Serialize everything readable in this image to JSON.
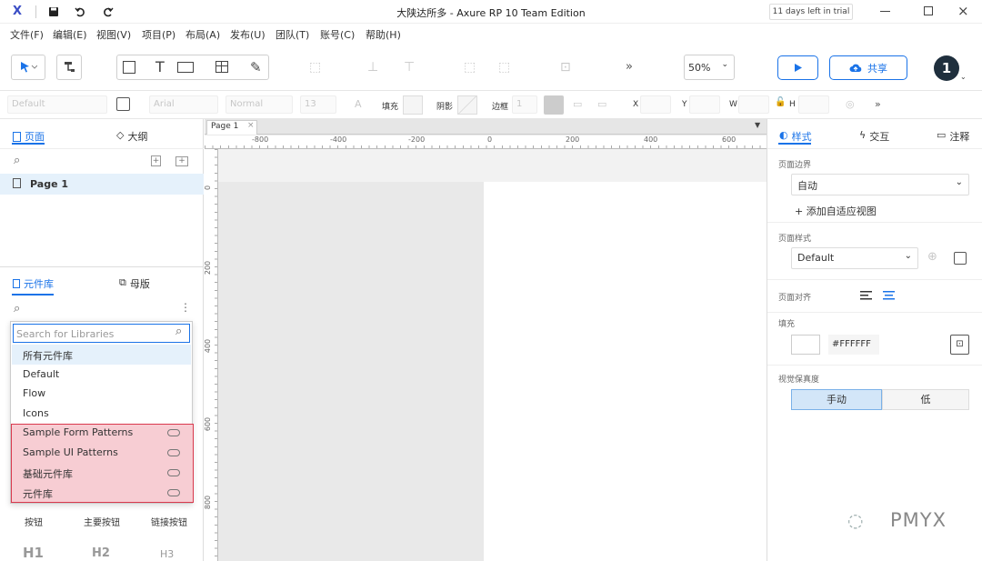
{
  "window": {
    "title": "大陕达所多 - Axure RP 10 Team Edition",
    "trial_badge": "11 days left in trial",
    "app_logo": "X"
  },
  "menu": [
    "文件(F)",
    "编辑(E)",
    "视图(V)",
    "项目(P)",
    "布局(A)",
    "发布(U)",
    "团队(T)",
    "账号(C)",
    "帮助(H)"
  ],
  "toolbar": {
    "zoom": "50%",
    "share_label": "共享",
    "avatar_text": "1",
    "more": "»"
  },
  "stylebar": {
    "style_value": "Default",
    "font_value": "Arial",
    "weight_value": "Normal",
    "size_value": "13",
    "fill_label": "填充",
    "shadow_label": "阴影",
    "border_label": "边框",
    "border_value": "1",
    "x_label": "X",
    "y_label": "Y",
    "w_label": "W",
    "h_label": "H"
  },
  "left_panel": {
    "tab_pages": "页面",
    "tab_outline": "大纲",
    "page_item": "Page 1",
    "tab_libraries": "元件库",
    "tab_masters": "母版",
    "search_placeholder": "Search for Libraries",
    "libraries": [
      {
        "label": "所有元件库"
      },
      {
        "label": "Default"
      },
      {
        "label": "Flow"
      },
      {
        "label": "Icons"
      }
    ],
    "cloud_libraries": [
      {
        "label": "Sample Form Patterns"
      },
      {
        "label": "Sample UI Patterns"
      },
      {
        "label": "基础元件库"
      },
      {
        "label": "元件库"
      }
    ],
    "widgets": [
      "按钮",
      "主要按钮",
      "链接按钮"
    ],
    "headings": [
      "H1",
      "H2",
      "H3"
    ]
  },
  "canvas": {
    "tab_label": "Page 1",
    "ruler_h": [
      "-800",
      "-400",
      "-200",
      "0",
      "200",
      "400",
      "600"
    ],
    "ruler_v": [
      "0",
      "200",
      "400",
      "600",
      "800"
    ]
  },
  "right_panel": {
    "tab_style": "样式",
    "tab_interact": "交互",
    "tab_notes": "注释",
    "page_dimension_title": "页面边界",
    "page_dimension_value": "自动",
    "add_adaptive": "+ 添加自适应视图",
    "page_style_title": "页面样式",
    "page_style_value": "Default",
    "page_align_title": "页面对齐",
    "fill_title": "填充",
    "fill_color": "#FFFFFF",
    "fidelity_title": "视觉保真度",
    "fidelity_manual": "手动",
    "fidelity_low": "低"
  },
  "watermark": "PMYX",
  "colors": {
    "accent": "#1a73e8",
    "highlight": "#f7cdd3",
    "highlight_border": "#d9394d",
    "selected_row": "#e5f1fb"
  }
}
